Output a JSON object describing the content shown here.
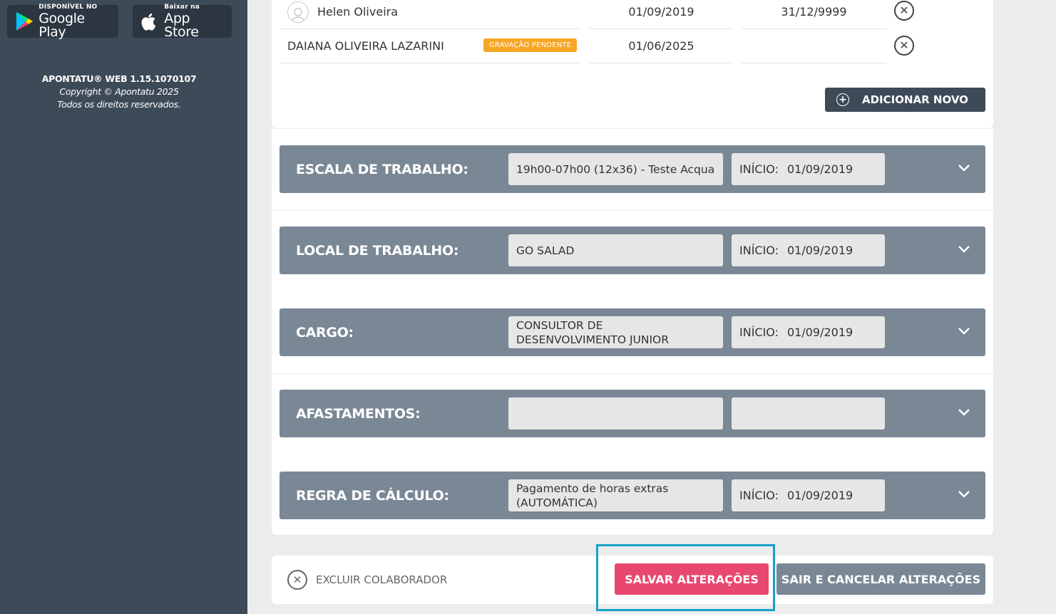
{
  "sidebar": {
    "google_play": {
      "small": "DISPONÍVEL NO",
      "big": "Google Play"
    },
    "app_store": {
      "small": "Baixar na",
      "big": "App Store"
    },
    "version": "APONTATU® WEB 1.15.1070107",
    "copyright": "Copyright © Apontatu 2025",
    "rights": "Todos os direitos reservados."
  },
  "rows": [
    {
      "name": "Helen Oliveira",
      "start": "01/09/2019",
      "end": "31/12/9999",
      "badge": ""
    },
    {
      "name": "DAIANA OLIVEIRA LAZARINI",
      "start": "01/06/2025",
      "end": "",
      "badge": "GRAVAÇÃO PENDENTE"
    }
  ],
  "add_new_label": "ADICIONAR NOVO",
  "sections": [
    {
      "title": "ESCALA DE TRABALHO:",
      "value": "19h00-07h00 (12x36) - Teste Acqua",
      "start_label": "INÍCIO:",
      "start": "01/09/2019"
    },
    {
      "title": "LOCAL DE TRABALHO:",
      "value": "GO SALAD",
      "start_label": "INÍCIO:",
      "start": "01/09/2019"
    },
    {
      "title": "CARGO:",
      "value": "CONSULTOR DE DESENVOLVIMENTO JUNIOR",
      "start_label": "INÍCIO:",
      "start": "01/09/2019"
    },
    {
      "title": "AFASTAMENTOS:",
      "value": "",
      "start_label": "",
      "start": ""
    },
    {
      "title": "REGRA DE CÁLCULO:",
      "value": "Pagamento de horas extras (AUTOMÁTICA)",
      "start_label": "INÍCIO:",
      "start": "01/09/2019"
    }
  ],
  "footer": {
    "delete_label": "EXCLUIR COLABORADOR",
    "save_label": "SALVAR ALTERAÇÕES",
    "cancel_label": "SAIR E CANCELAR ALTERAÇÕES"
  },
  "colors": {
    "sidebar": "#3d4a58",
    "section_bar": "#7a8795",
    "save": "#e84870",
    "badge": "#f5a623",
    "highlight": "#16a1c9"
  },
  "icons": [
    "google-play-icon",
    "apple-icon",
    "avatar-icon",
    "remove-icon",
    "plus-icon",
    "chevron-down-icon",
    "delete-icon"
  ]
}
